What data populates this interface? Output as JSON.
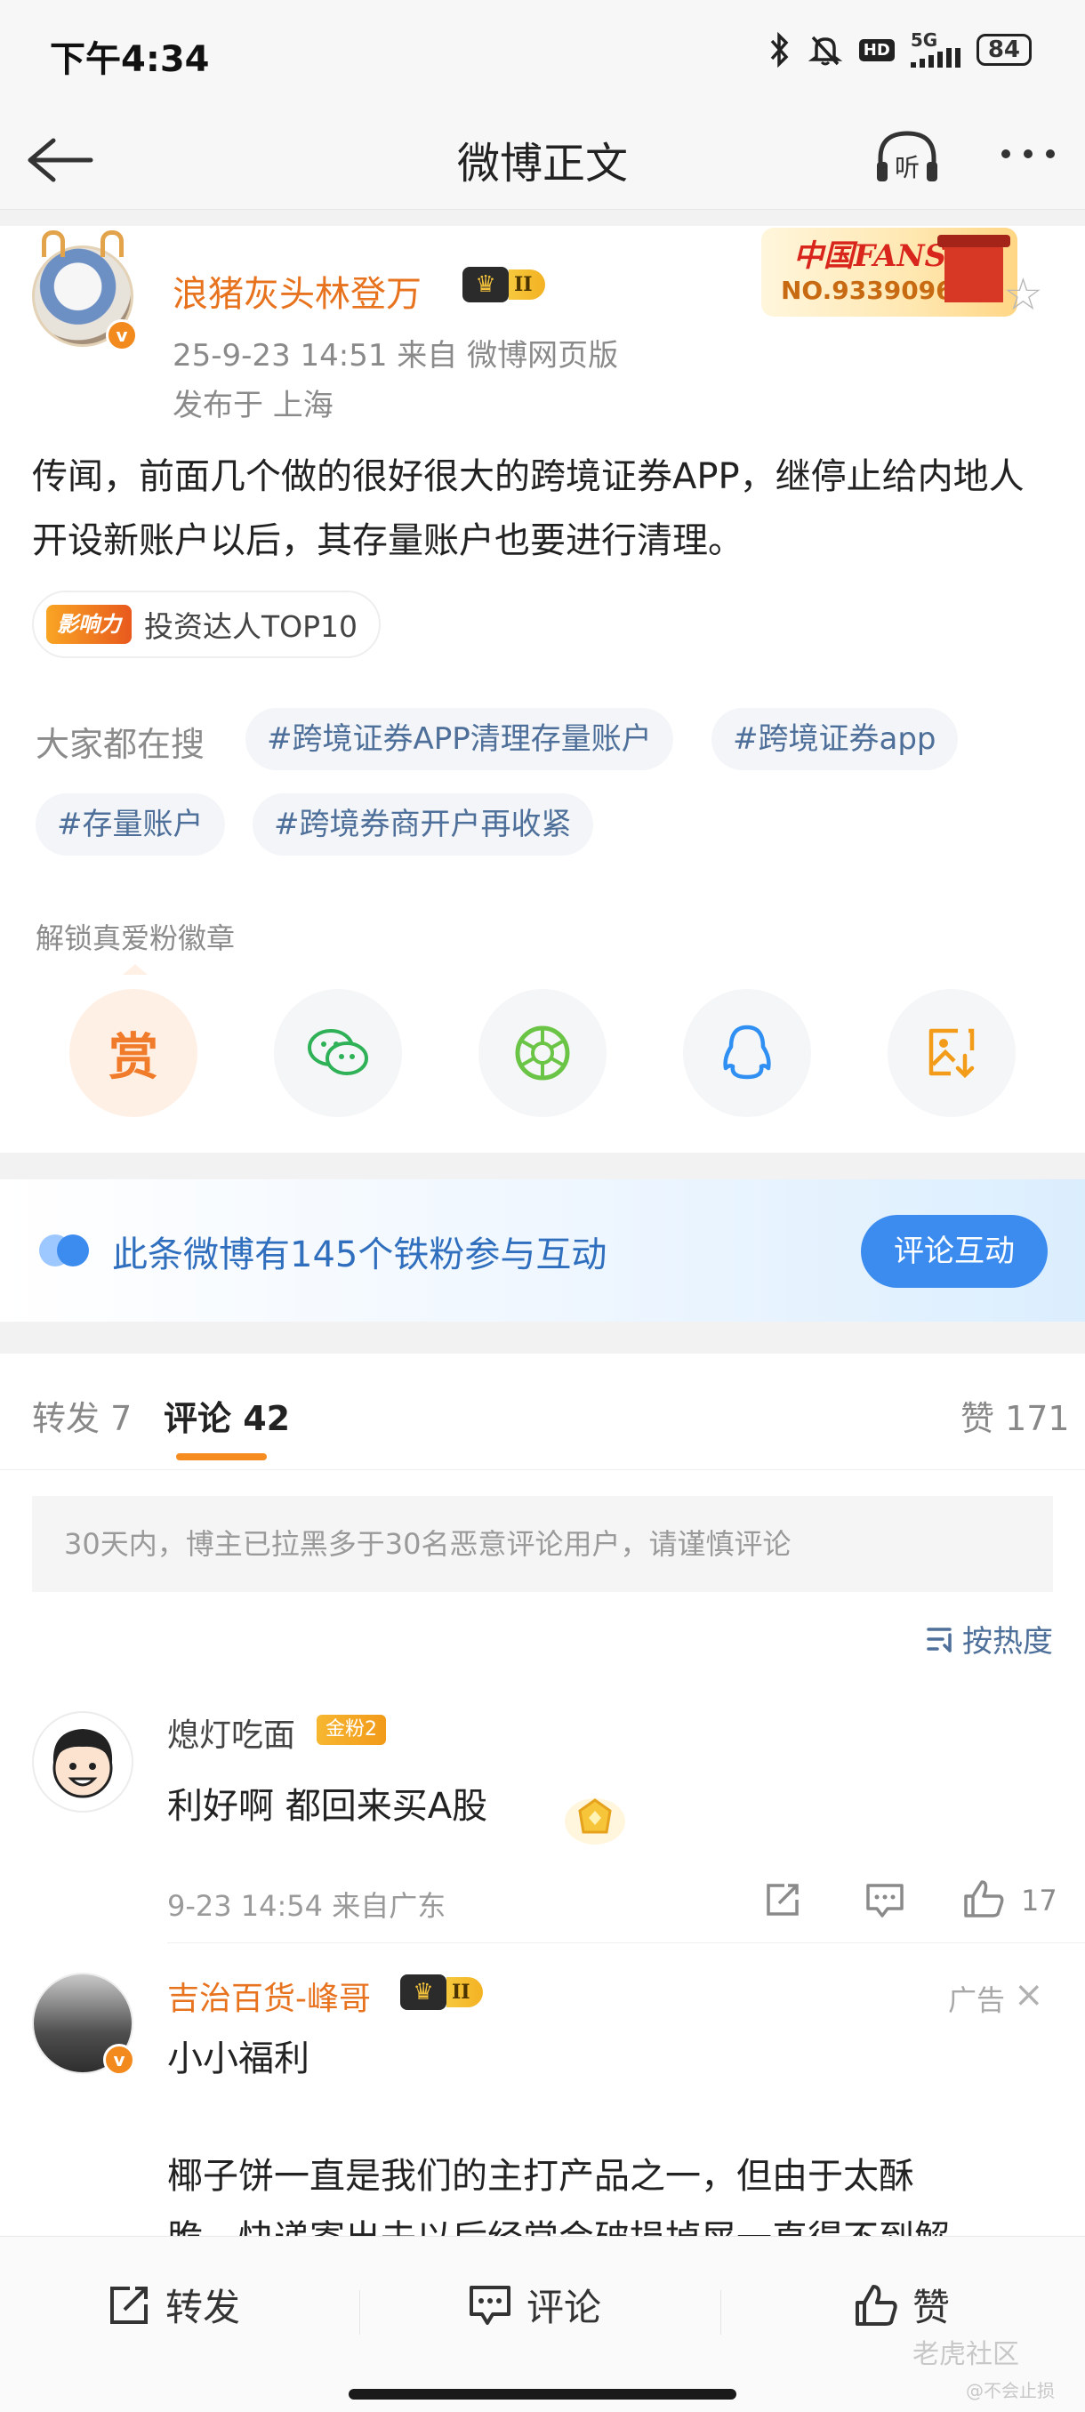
{
  "status_bar": {
    "time": "下午4:34",
    "network": "5G",
    "hd": "HD",
    "battery": "84"
  },
  "nav": {
    "title": "微博正文",
    "listen_label": "听"
  },
  "post": {
    "author": "浪猪灰头林登万",
    "crown_level": "II",
    "meta": "25-9-23 14:51  来自 微博网页版",
    "location": "发布于 上海",
    "fans_badge_title": "中国FANS",
    "fans_badge_no": "NO.9339096",
    "text": "传闻，前面几个做的很好很大的跨境证券APP，继停止给内地人开设新账户以后，其存量账户也要进行清理。",
    "influence_badge": "影响力",
    "influence_text": "投资达人TOP10",
    "search_label": "大家都在搜",
    "search_chips": [
      "#跨境证券APP清理存量账户",
      "#跨境证券app",
      "#存量账户",
      "#跨境券商开户再收紧"
    ],
    "unlock_label": "解锁真爱粉徽章",
    "reward_label": "赏"
  },
  "ironfans": {
    "text": "此条微博有145个铁粉参与互动",
    "button": "评论互动"
  },
  "tabs": {
    "repost": "转发 7",
    "comment": "评论 42",
    "like": "赞 171"
  },
  "notice": "30天内，博主已拉黑多于30名恶意评论用户，请谨慎评论",
  "sort_label": "按热度",
  "comments": [
    {
      "name": "熄灯吃面",
      "badge": "金粉2",
      "text": "利好啊  都回来买A股",
      "meta": "9-23 14:54  来自广东",
      "likes": "17"
    }
  ],
  "ad": {
    "name": "吉治百货-峰哥",
    "crown_level": "II",
    "tag": "广告",
    "line1": "小小福利",
    "line2": "椰子饼一直是我们的主打产品之一，但由于太酥",
    "line3": "脆，快递寄出去以后经常会破损掉屑一直得不到解"
  },
  "bottom_bar": {
    "repost": "转发",
    "comment": "评论",
    "like": "赞"
  },
  "watermark": {
    "main": "老虎社区",
    "sub": "@不会止损"
  },
  "colors": {
    "accent": "#e8731f",
    "link": "#4d6f99",
    "tab_underline": "#f68b1f",
    "button_blue": "#3c8cf0"
  }
}
